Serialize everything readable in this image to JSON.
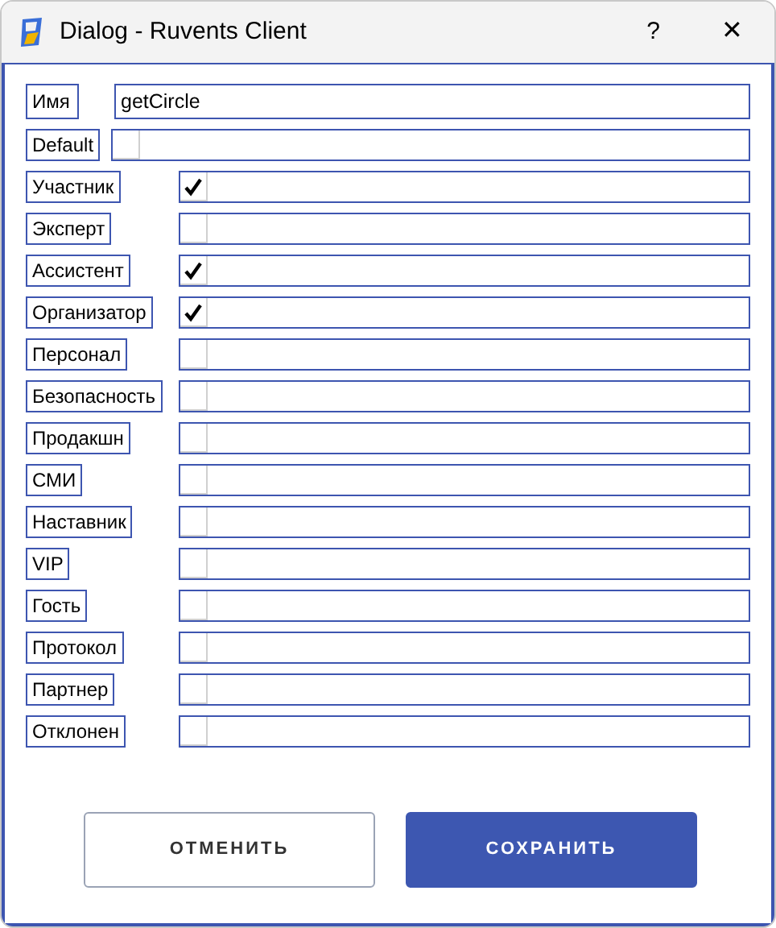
{
  "window": {
    "title": "Dialog - Ruvents Client",
    "help": "?",
    "close": "✕"
  },
  "name_field": {
    "label": "Имя",
    "value": "getCircle"
  },
  "default_field": {
    "label": "Default",
    "checked": false
  },
  "roles": [
    {
      "label": "Участник",
      "checked": true
    },
    {
      "label": "Эксперт",
      "checked": false
    },
    {
      "label": "Ассистент",
      "checked": true
    },
    {
      "label": "Организатор",
      "checked": true
    },
    {
      "label": "Персонал",
      "checked": false
    },
    {
      "label": "Безопасность",
      "checked": false
    },
    {
      "label": "Продакшн",
      "checked": false
    },
    {
      "label": "СМИ",
      "checked": false
    },
    {
      "label": "Наставник",
      "checked": false
    },
    {
      "label": "VIP",
      "checked": false
    },
    {
      "label": "Гость",
      "checked": false
    },
    {
      "label": "Протокол",
      "checked": false
    },
    {
      "label": "Партнер",
      "checked": false
    },
    {
      "label": "Отклонен",
      "checked": false
    }
  ],
  "buttons": [
    {
      "label": "ОТМЕНИТЬ",
      "kind": "secondary"
    },
    {
      "label": "СОХРАНИТЬ",
      "kind": "primary"
    }
  ]
}
